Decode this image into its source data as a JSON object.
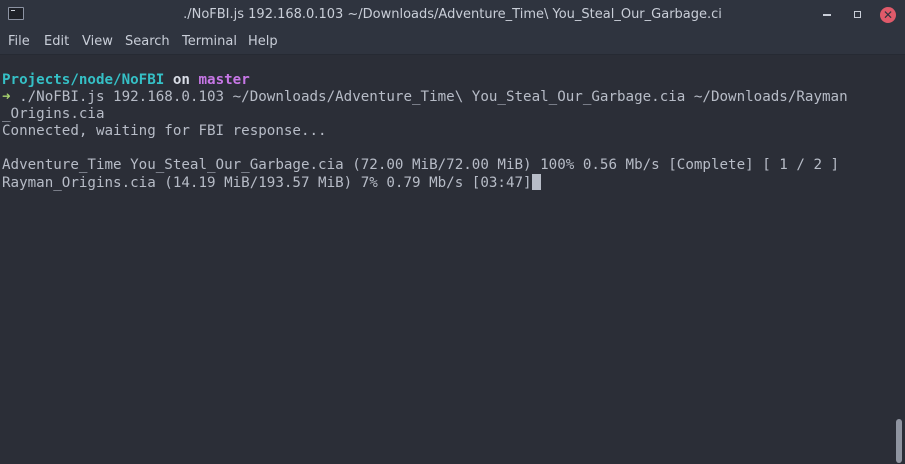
{
  "window": {
    "title": "./NoFBI.js 192.168.0.103 ~/Downloads/Adventure_Time\\ You_Steal_Our_Garbage.ci",
    "icon": "terminal-icon",
    "controls": {
      "minimize_icon": "minimize-icon",
      "maximize_icon": "maximize-icon",
      "close_icon": "close-icon",
      "close_glyph": "✕"
    }
  },
  "menu": {
    "items": [
      "File",
      "Edit",
      "View",
      "Search",
      "Terminal",
      "Help"
    ]
  },
  "terminal": {
    "prompt": {
      "path": "Projects/node/NoFBI",
      "on": "on",
      "branch": "master",
      "arrow": "➜",
      "command": "./NoFBI.js 192.168.0.103 ~/Downloads/Adventure_Time\\ You_Steal_Our_Garbage.cia ~/Downloads/Rayman",
      "command_wrap": "_Origins.cia"
    },
    "output": [
      "Connected, waiting for FBI response...",
      "",
      "Adventure_Time You_Steal_Our_Garbage.cia (72.00 MiB/72.00 MiB) 100% 0.56 Mb/s [Complete] [ 1 / 2 ]",
      "Rayman_Origins.cia (14.19 MiB/193.57 MiB) 7% 0.79 Mb/s [03:47]"
    ]
  },
  "colors": {
    "background": "#2b2e37",
    "chrome": "#2f343f",
    "text": "#b7bcc7",
    "path": "#35c0c6",
    "branch": "#c777e6",
    "arrow": "#a8d46f",
    "close": "#e05a6a"
  }
}
